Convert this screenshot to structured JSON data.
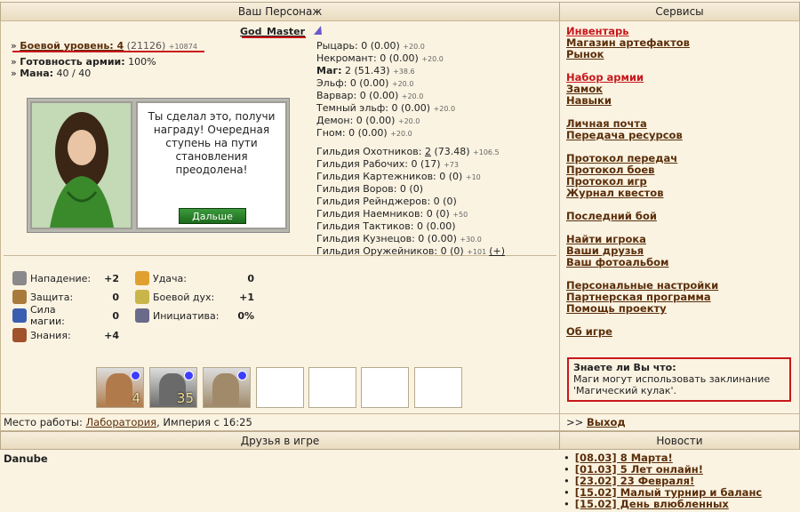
{
  "headers": {
    "character": "Ваш Персонаж",
    "services": "Сервисы",
    "friends": "Друзья в игре",
    "news": "Новости"
  },
  "player": {
    "name": "God_Master",
    "combat_level_label": "Боевой уровень:",
    "combat_level": "4",
    "combat_exp": "(21126)",
    "combat_exp_next": "+10874",
    "army_ready_label": "Готовность армии:",
    "army_ready": "100%",
    "mana_label": "Мана:",
    "mana": "40 / 40"
  },
  "factions": [
    {
      "name": "Рыцарь:",
      "value": "0 (0.00)",
      "delta": "+20.0"
    },
    {
      "name": "Некромант:",
      "value": "0 (0.00)",
      "delta": "+20.0"
    },
    {
      "name": "Маг:",
      "value": "2 (51.43)",
      "delta": "+38.6"
    },
    {
      "name": "Эльф:",
      "value": "0 (0.00)",
      "delta": "+20.0"
    },
    {
      "name": "Варвар:",
      "value": "0 (0.00)",
      "delta": "+20.0"
    },
    {
      "name": "Темный эльф:",
      "value": "0 (0.00)",
      "delta": "+20.0"
    },
    {
      "name": "Демон:",
      "value": "0 (0.00)",
      "delta": "+20.0"
    },
    {
      "name": "Гном:",
      "value": "0 (0.00)",
      "delta": "+20.0"
    }
  ],
  "guilds": [
    {
      "name": "Гильдия Охотников:",
      "value_a": "2",
      "value_b": "(73.48)",
      "delta": "+106.5"
    },
    {
      "name": "Гильдия Рабочих:",
      "value_a": "0",
      "value_b": "(17)",
      "delta": "+73"
    },
    {
      "name": "Гильдия Картежников:",
      "value_a": "0",
      "value_b": "(0)",
      "delta": "+10"
    },
    {
      "name": "Гильдия Воров:",
      "value_a": "0",
      "value_b": "(0)",
      "delta": ""
    },
    {
      "name": "Гильдия Рейнджеров:",
      "value_a": "0",
      "value_b": "(0)",
      "delta": ""
    },
    {
      "name": "Гильдия Наемников:",
      "value_a": "0",
      "value_b": "(0)",
      "delta": "+50"
    },
    {
      "name": "Гильдия Тактиков:",
      "value_a": "0",
      "value_b": "(0.00)",
      "delta": ""
    },
    {
      "name": "Гильдия Кузнецов:",
      "value_a": "0",
      "value_b": "(0.00)",
      "delta": "+30.0"
    },
    {
      "name": "Гильдия Оружейников:",
      "value_a": "0",
      "value_b": "(0)",
      "delta": "+101"
    }
  ],
  "guild_plus": "(+)",
  "dialog": {
    "text": "Ты сделал это, получи награду! Очередная ступень на пути становления преодолена!",
    "button": "Дальше"
  },
  "stats": [
    {
      "label": "Нападение:",
      "value": "+2",
      "icon": "sword-icon"
    },
    {
      "label": "Защита:",
      "value": "0",
      "icon": "shield-icon"
    },
    {
      "label": "Сила магии:",
      "value": "0",
      "icon": "wand-icon"
    },
    {
      "label": "Знания:",
      "value": "+4",
      "icon": "book-icon"
    },
    {
      "label": "Удача:",
      "value": "0",
      "icon": "rainbow-icon"
    },
    {
      "label": "Боевой дух:",
      "value": "+1",
      "icon": "wings-icon"
    },
    {
      "label": "Инициатива:",
      "value": "0%",
      "icon": "hourglass-icon"
    }
  ],
  "army": [
    {
      "count": "4"
    },
    {
      "count": "35"
    },
    {
      "count": ""
    }
  ],
  "workplace": {
    "label": "Место работы:",
    "place": "Лаборатория",
    "rest": ", Империя с 16:25"
  },
  "services": {
    "g1": [
      "Инвентарь",
      "Магазин артефактов",
      "Рынок"
    ],
    "g2": [
      "Набор армии",
      "Замок",
      "Навыки"
    ],
    "g3": [
      "Личная почта",
      "Передача ресурсов"
    ],
    "g4": [
      "Протокол передач",
      "Протокол боев",
      "Протокол игр",
      "Журнал квестов"
    ],
    "g5": [
      "Последний бой"
    ],
    "g6": [
      "Найти игрока",
      "Ваши друзья",
      "Ваш фотоальбом"
    ],
    "g7": [
      "Персональные настройки",
      "Партнерская программа",
      "Помощь проекту"
    ],
    "g8": [
      "Об игре"
    ]
  },
  "tip": {
    "title": "Знаете ли Вы что:",
    "text": "Маги могут использовать заклинание 'Магический кулак'."
  },
  "logout": {
    "prefix": ">>",
    "label": "Выход"
  },
  "friends": [
    "Danube"
  ],
  "news": [
    "[08.03] 8 Марта!",
    "[01.03] 5 Лет онлайн!",
    "[23.02] 23 Февраля!",
    "[15.02] Малый турнир и баланс",
    "[15.02] День влюбленных"
  ],
  "colors": {
    "accent_red": "#c8171b",
    "link": "#5a2e0a",
    "bg": "#fbf3e2"
  }
}
